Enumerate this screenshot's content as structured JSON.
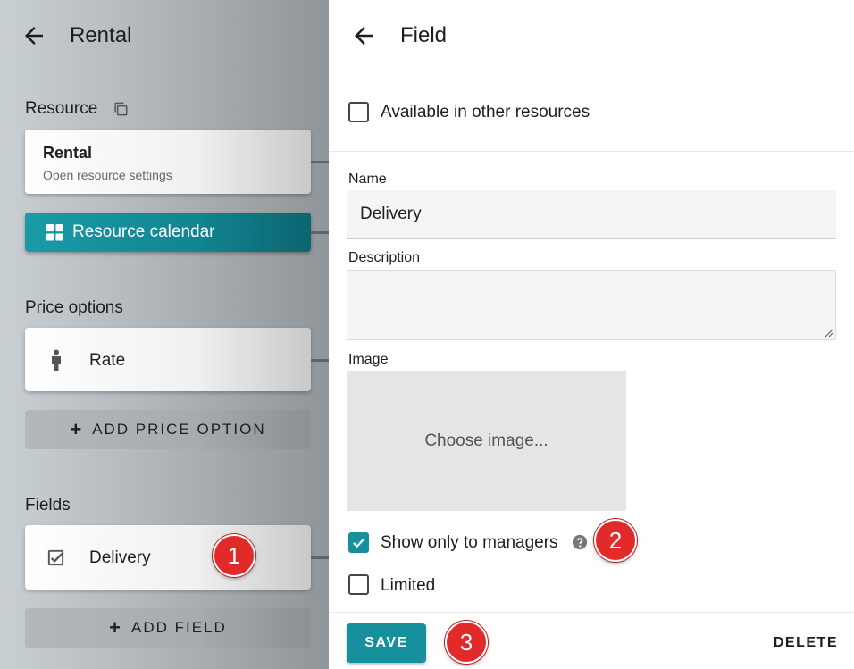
{
  "left_panel": {
    "title": "Rental",
    "resource_label": "Resource",
    "resource_card": {
      "title": "Rental",
      "subtitle": "Open resource settings"
    },
    "calendar_button": "Resource calendar",
    "price_options_label": "Price options",
    "price_option_card": {
      "label": "Rate"
    },
    "add_price_option": "ADD PRICE OPTION",
    "fields_label": "Fields",
    "field_card": {
      "label": "Delivery"
    },
    "add_field": "ADD FIELD"
  },
  "right_panel": {
    "title": "Field",
    "available_in_other_resources": {
      "label": "Available in other resources",
      "checked": false
    },
    "name": {
      "label": "Name",
      "value": "Delivery"
    },
    "description": {
      "label": "Description",
      "value": ""
    },
    "image": {
      "label": "Image",
      "placeholder": "Choose image..."
    },
    "show_only_to_managers": {
      "label": "Show only to managers",
      "checked": true
    },
    "limited": {
      "label": "Limited",
      "checked": false
    },
    "save": "SAVE",
    "delete": "DELETE"
  },
  "badges": [
    "1",
    "2",
    "3"
  ],
  "colors": {
    "accent": "#16909c",
    "badge": "#e22a2a"
  }
}
